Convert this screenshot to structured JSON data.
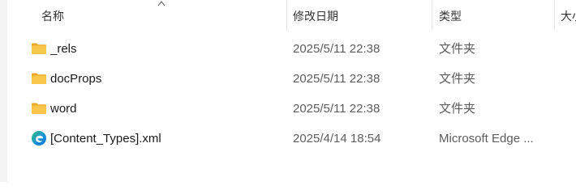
{
  "columns": {
    "name": "名称",
    "modified": "修改日期",
    "type": "类型",
    "size": "大小"
  },
  "rows": [
    {
      "name": "_rels",
      "modified": "2025/5/11 22:38",
      "type": "文件夹",
      "icon": "folder-icon"
    },
    {
      "name": "docProps",
      "modified": "2025/5/11 22:38",
      "type": "文件夹",
      "icon": "folder-icon"
    },
    {
      "name": "word",
      "modified": "2025/5/11 22:38",
      "type": "文件夹",
      "icon": "folder-icon"
    },
    {
      "name": "[Content_Types].xml",
      "modified": "2025/4/14 18:54",
      "type": "Microsoft Edge ...",
      "icon": "edge-icon"
    }
  ],
  "colors": {
    "folder": "#f8c64a",
    "folder_dark": "#e9a92a",
    "edge_blue": "#0c6fd1",
    "edge_green": "#34c17a"
  }
}
